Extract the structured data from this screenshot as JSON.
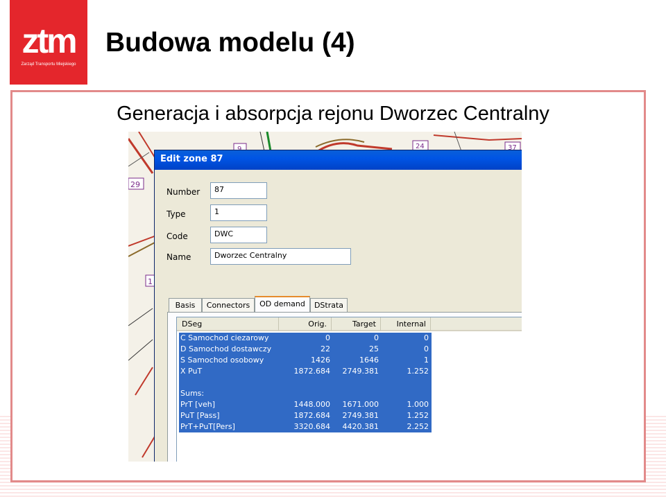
{
  "slide": {
    "title": "Budowa modelu (4)",
    "subtitle": "Generacja i absorpcja rejonu Dworzec Centralny"
  },
  "logo": {
    "word": "ztm",
    "tagline": "Zarząd Transportu Miejskiego"
  },
  "map": {
    "zone_labels": [
      "9",
      "24",
      "37",
      "29",
      "1"
    ]
  },
  "dialog": {
    "title": "Edit zone 87",
    "fields": {
      "number_label": "Number",
      "number_value": "87",
      "type_label": "Type",
      "type_value": "1",
      "code_label": "Code",
      "code_value": "DWC",
      "name_label": "Name",
      "name_value": "Dworzec Centralny"
    },
    "tabs": [
      "Basis",
      "Connectors",
      "OD demand",
      "DStrata"
    ],
    "active_tab": "OD demand",
    "table": {
      "headers": [
        "DSeg",
        "Orig.",
        "Target",
        "Internal"
      ],
      "rows": [
        [
          "C Samochod ciezarowy",
          "0",
          "0",
          "0"
        ],
        [
          "D Samochod dostawczy",
          "22",
          "25",
          "0"
        ],
        [
          "S Samochod osobowy",
          "1426",
          "1646",
          "1"
        ],
        [
          "X PuT",
          "1872.684",
          "2749.381",
          "1.252"
        ],
        [
          "",
          "",
          "",
          ""
        ],
        [
          "Sums:",
          "",
          "",
          ""
        ],
        [
          "PrT [veh]",
          "1448.000",
          "1671.000",
          "1.000"
        ],
        [
          "PuT [Pass]",
          "1872.684",
          "2749.381",
          "1.252"
        ],
        [
          "PrT+PuT[Pers]",
          "3320.684",
          "4420.381",
          "2.252"
        ]
      ]
    }
  },
  "colors": {
    "accent": "#e4262c",
    "frame": "#e28a8a",
    "selection": "#316ac5",
    "titlebar": "#0055e5"
  }
}
